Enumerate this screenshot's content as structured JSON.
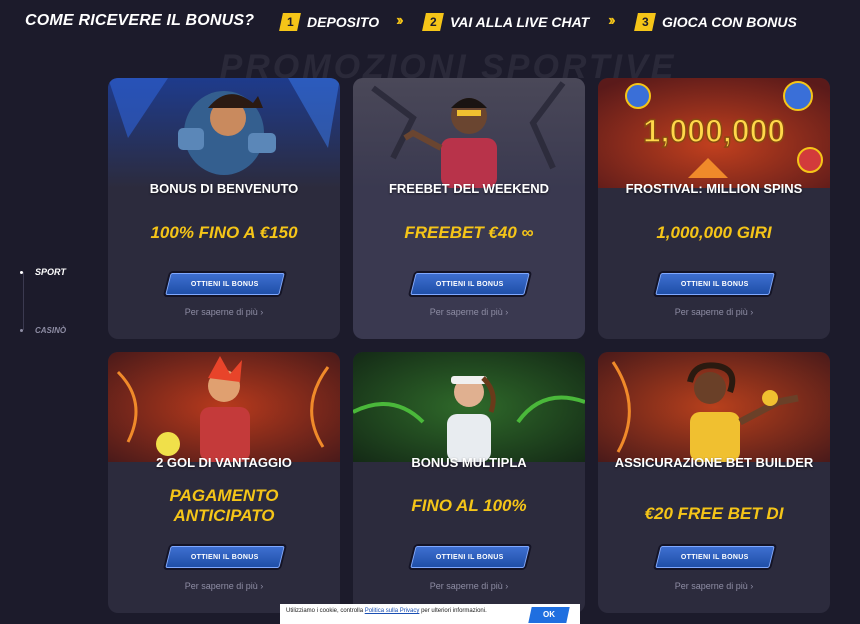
{
  "steps": {
    "title": "COME RICEVERE IL BONUS?",
    "items": [
      {
        "num": "1",
        "label": "DEPOSITO"
      },
      {
        "num": "2",
        "label": "VAI ALLA LIVE CHAT"
      },
      {
        "num": "3",
        "label": "GIOCA CON BONUS"
      }
    ]
  },
  "watermark": "PROMOZIONI SPORTIVE",
  "nav": {
    "sport": "SPORT",
    "casino": "CASINÒ"
  },
  "cards": [
    {
      "title": "BONUS DI BENVENUTO",
      "offer": "100% FINO A €150",
      "button": "OTTIENI IL BONUS",
      "more": "Per saperne di più ›"
    },
    {
      "title": "FREEBET DEL WEEKEND",
      "offer": "FREEBET €40 ∞",
      "button": "OTTIENI IL BONUS",
      "more": "Per saperne di più ›"
    },
    {
      "title": "FROSTIVAL: MILLION SPINS",
      "offer": "1,000,000 GIRI",
      "button": "OTTIENI IL BONUS",
      "more": "Per saperne di più ›",
      "art_text": "1,000,000"
    },
    {
      "title": "2 GOL DI VANTAGGIO",
      "offer": "PAGAMENTO ANTICIPATO",
      "button": "OTTIENI IL BONUS",
      "more": "Per saperne di più ›"
    },
    {
      "title": "BONUS MULTIPLA",
      "offer": "FINO AL 100%",
      "button": "OTTIENI IL BONUS",
      "more": "Per saperne di più ›"
    },
    {
      "title": "ASSICURAZIONE BET BUILDER",
      "offer": "€20 FREE BET DI",
      "button": "OTTIENI IL BONUS",
      "more": "Per saperne di più ›"
    }
  ],
  "cookie": {
    "text_before": "Utilizziamo i cookie, controlla",
    "link": "Politica sulla Privacy",
    "text_after": "per ulteriori informazioni.",
    "ok": "OK"
  },
  "colors": {
    "background": "#1c1b2b",
    "card": "#2c2b3d",
    "accent_yellow": "#f5c518",
    "button_blue": "#2a5cc0"
  }
}
